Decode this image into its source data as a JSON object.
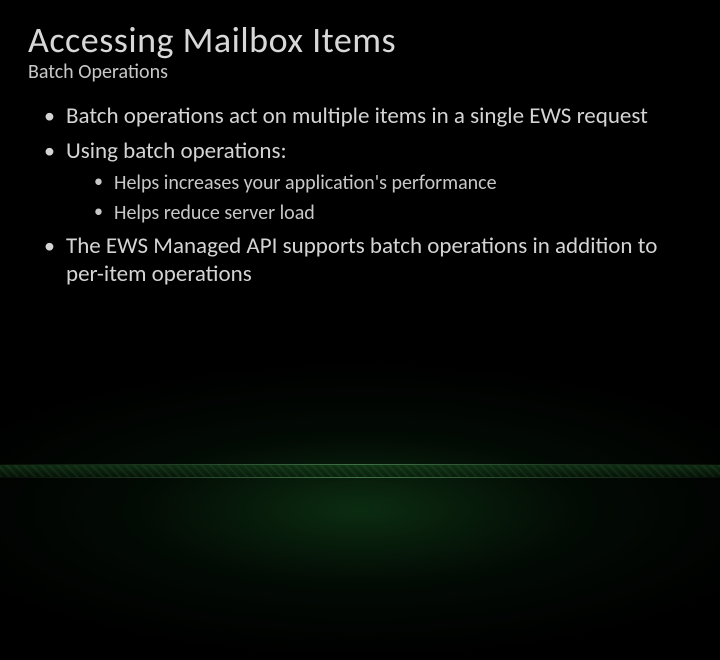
{
  "title": "Accessing Mailbox Items",
  "subtitle": "Batch Operations",
  "bullets": {
    "b0": "Batch operations act on multiple items in a single EWS request",
    "b1": "Using batch operations:",
    "b1_sub": {
      "s0": "Helps increases your application's performance",
      "s1": "Helps reduce server load"
    },
    "b2": "The EWS Managed API supports batch operations in addition to per-item operations"
  }
}
